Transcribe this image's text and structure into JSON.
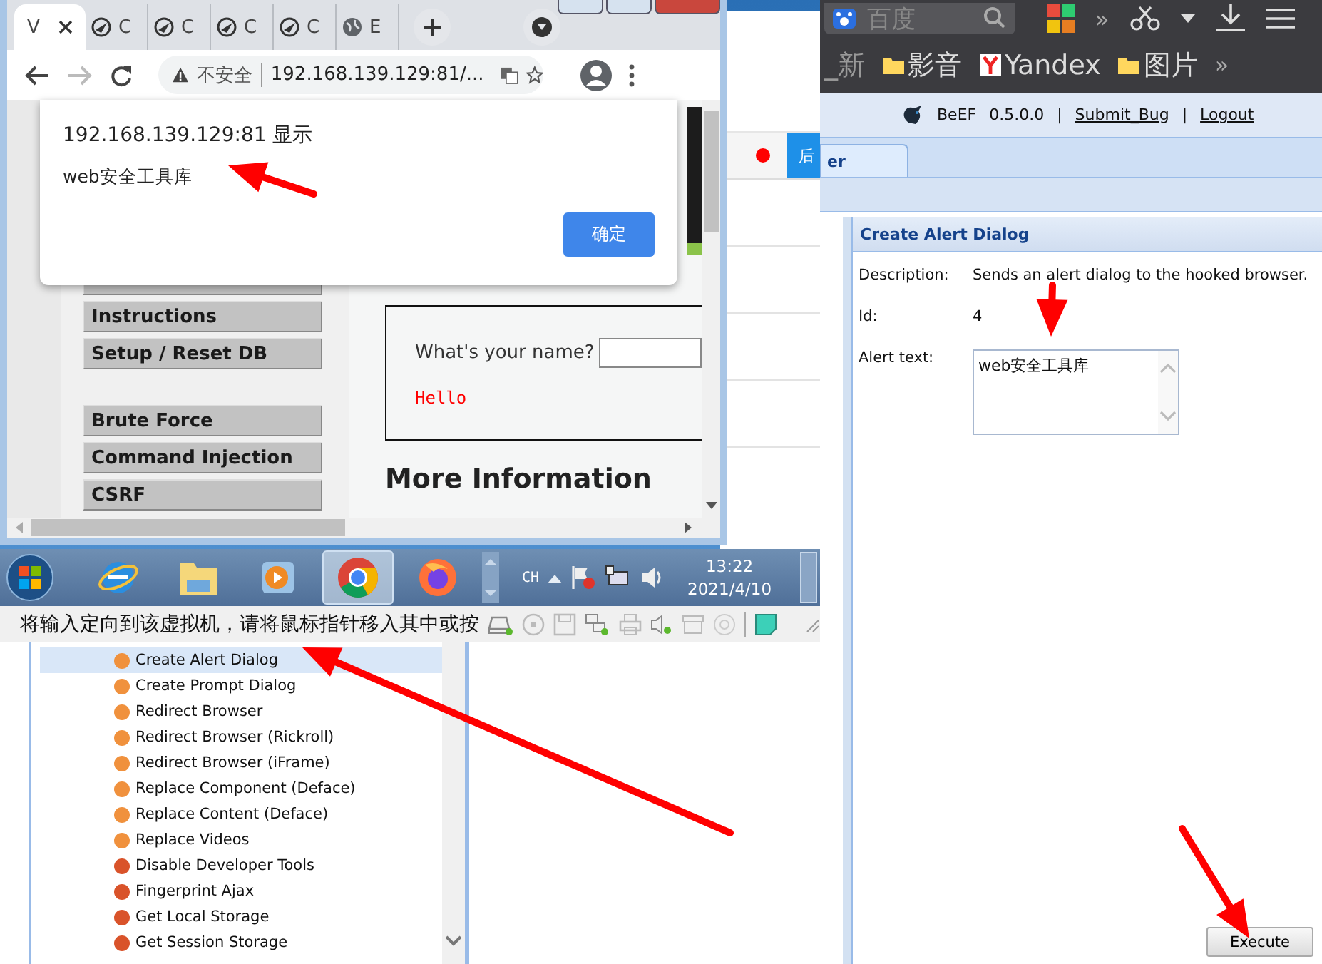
{
  "browser360": {
    "search_placeholder": "百度",
    "toolbar_overflow": "»",
    "bookmarks": [
      {
        "label": "_新",
        "kind": "text"
      },
      {
        "label": "影音",
        "kind": "folder"
      },
      {
        "label": "Yandex",
        "kind": "yandex"
      },
      {
        "label": "图片",
        "kind": "folder"
      }
    ],
    "bookmarks_overflow": "»"
  },
  "beef": {
    "header_items": [
      {
        "kind": "text",
        "label": "BeEF"
      },
      {
        "kind": "text",
        "label": "0.5.0.0"
      },
      {
        "kind": "sep",
        "label": "|"
      },
      {
        "kind": "link",
        "label": "Submit_Bug"
      },
      {
        "kind": "sep",
        "label": "|"
      },
      {
        "kind": "link",
        "label": "Logout"
      }
    ],
    "tabs": [
      {
        "label": "er",
        "selected": true
      }
    ],
    "module_tree": [
      {
        "label": "Create Alert Dialog",
        "color": "#f0913d",
        "selected": true
      },
      {
        "label": "Create Prompt Dialog",
        "color": "#f0913d",
        "selected": false
      },
      {
        "label": "Redirect Browser",
        "color": "#f0913d",
        "selected": false
      },
      {
        "label": "Redirect Browser (Rickroll)",
        "color": "#f0913d",
        "selected": false
      },
      {
        "label": "Redirect Browser (iFrame)",
        "color": "#f0913d",
        "selected": false
      },
      {
        "label": "Replace Component (Deface)",
        "color": "#f0913d",
        "selected": false
      },
      {
        "label": "Replace Content (Deface)",
        "color": "#f0913d",
        "selected": false
      },
      {
        "label": "Replace Videos",
        "color": "#f0913d",
        "selected": false
      },
      {
        "label": "Disable Developer Tools",
        "color": "#d9532a",
        "selected": false
      },
      {
        "label": "Fingerprint Ajax",
        "color": "#d9532a",
        "selected": false
      },
      {
        "label": "Get Local Storage",
        "color": "#d9532a",
        "selected": false
      },
      {
        "label": "Get Session Storage",
        "color": "#d9532a",
        "selected": false
      }
    ],
    "module": {
      "title": "Create Alert Dialog",
      "fields": [
        {
          "label": "Description:",
          "kind": "text",
          "value": "Sends an alert dialog to the hooked browser."
        },
        {
          "label": "Id:",
          "kind": "text",
          "value": "4"
        },
        {
          "label": "Alert text:",
          "kind": "textarea",
          "value": "web安全工具库"
        }
      ],
      "execute_button": "Execute"
    }
  },
  "vm": {
    "guest_window_tab": "后",
    "chrome": {
      "tabs": [
        {
          "label": "V",
          "kind": "page",
          "selected": true
        },
        {
          "label": "C",
          "kind": "plane",
          "selected": false
        },
        {
          "label": "C",
          "kind": "plane",
          "selected": false
        },
        {
          "label": "C",
          "kind": "plane",
          "selected": false
        },
        {
          "label": "C",
          "kind": "plane",
          "selected": false
        },
        {
          "label": "E",
          "kind": "globe",
          "selected": false
        }
      ],
      "address": {
        "security": "不安全",
        "url": "192.168.139.129:81/..."
      },
      "dialog": {
        "title": "192.168.139.129:81 显示",
        "message": "web安全工具库",
        "ok_button": "确定"
      },
      "page": {
        "menu": [
          {
            "label": "Instructions",
            "kind": "button"
          },
          {
            "label": "Setup / Reset DB",
            "kind": "button"
          },
          {
            "kind": "gap"
          },
          {
            "label": "Brute Force",
            "kind": "button"
          },
          {
            "label": "Command Injection",
            "kind": "button"
          },
          {
            "label": "CSRF",
            "kind": "button"
          }
        ],
        "form_label": "What's your name?",
        "output": "Hello",
        "heading": "More Information"
      }
    },
    "taskbar": {
      "apps": [
        {
          "kind": "ie",
          "selected": false
        },
        {
          "kind": "explorer",
          "selected": false
        },
        {
          "kind": "media",
          "selected": false
        },
        {
          "kind": "chrome",
          "selected": true
        },
        {
          "kind": "firefox",
          "selected": false
        }
      ],
      "language": "CH",
      "time": "13:22",
      "date": "2021/4/10"
    },
    "status_text": "将输入定向到该虚拟机，请将鼠标指针移入其中或按"
  }
}
